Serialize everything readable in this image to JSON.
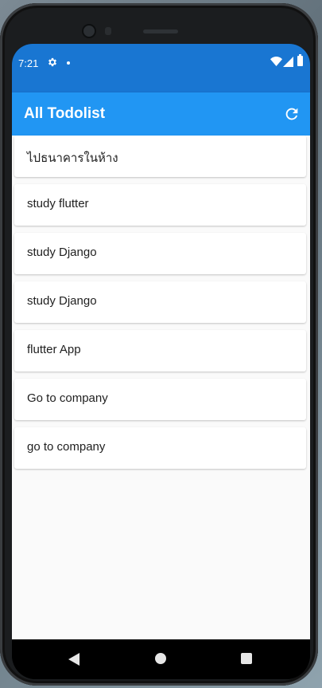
{
  "status_bar": {
    "time": "7:21"
  },
  "app_bar": {
    "title": "All Todolist"
  },
  "todos": [
    {
      "label": "ไปธนาคารในห้าง"
    },
    {
      "label": "study flutter"
    },
    {
      "label": "study Django"
    },
    {
      "label": "study Django"
    },
    {
      "label": "flutter App"
    },
    {
      "label": "Go to company"
    },
    {
      "label": "go to company"
    }
  ],
  "fab": {
    "icon": "+"
  },
  "icons": {
    "status": [
      "gear-icon",
      "notification-dot-icon",
      "wifi-icon",
      "signal-icon",
      "battery-icon"
    ],
    "app_bar": "refresh-icon",
    "nav": [
      "back-icon",
      "home-icon",
      "recent-apps-icon"
    ]
  },
  "colors": {
    "status_bar": "#1976d2",
    "app_bar": "#2196f3",
    "fab": "#2196f3",
    "background": "#fafafa"
  }
}
